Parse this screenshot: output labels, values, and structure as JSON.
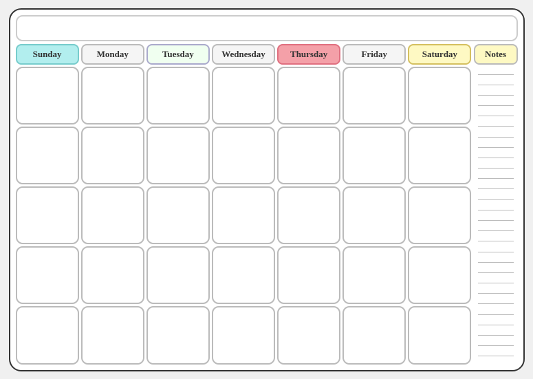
{
  "title": "",
  "days": [
    {
      "key": "sunday",
      "label": "Sunday",
      "class": "sunday"
    },
    {
      "key": "monday",
      "label": "Monday",
      "class": "monday"
    },
    {
      "key": "tuesday",
      "label": "Tuesday",
      "class": "tuesday"
    },
    {
      "key": "wednesday",
      "label": "Wednesday",
      "class": "wednesday"
    },
    {
      "key": "thursday",
      "label": "Thursday",
      "class": "thursday"
    },
    {
      "key": "friday",
      "label": "Friday",
      "class": "friday"
    },
    {
      "key": "saturday",
      "label": "Saturday",
      "class": "saturday"
    }
  ],
  "notes_label": "Notes",
  "num_weeks": 5,
  "num_note_lines": 28
}
